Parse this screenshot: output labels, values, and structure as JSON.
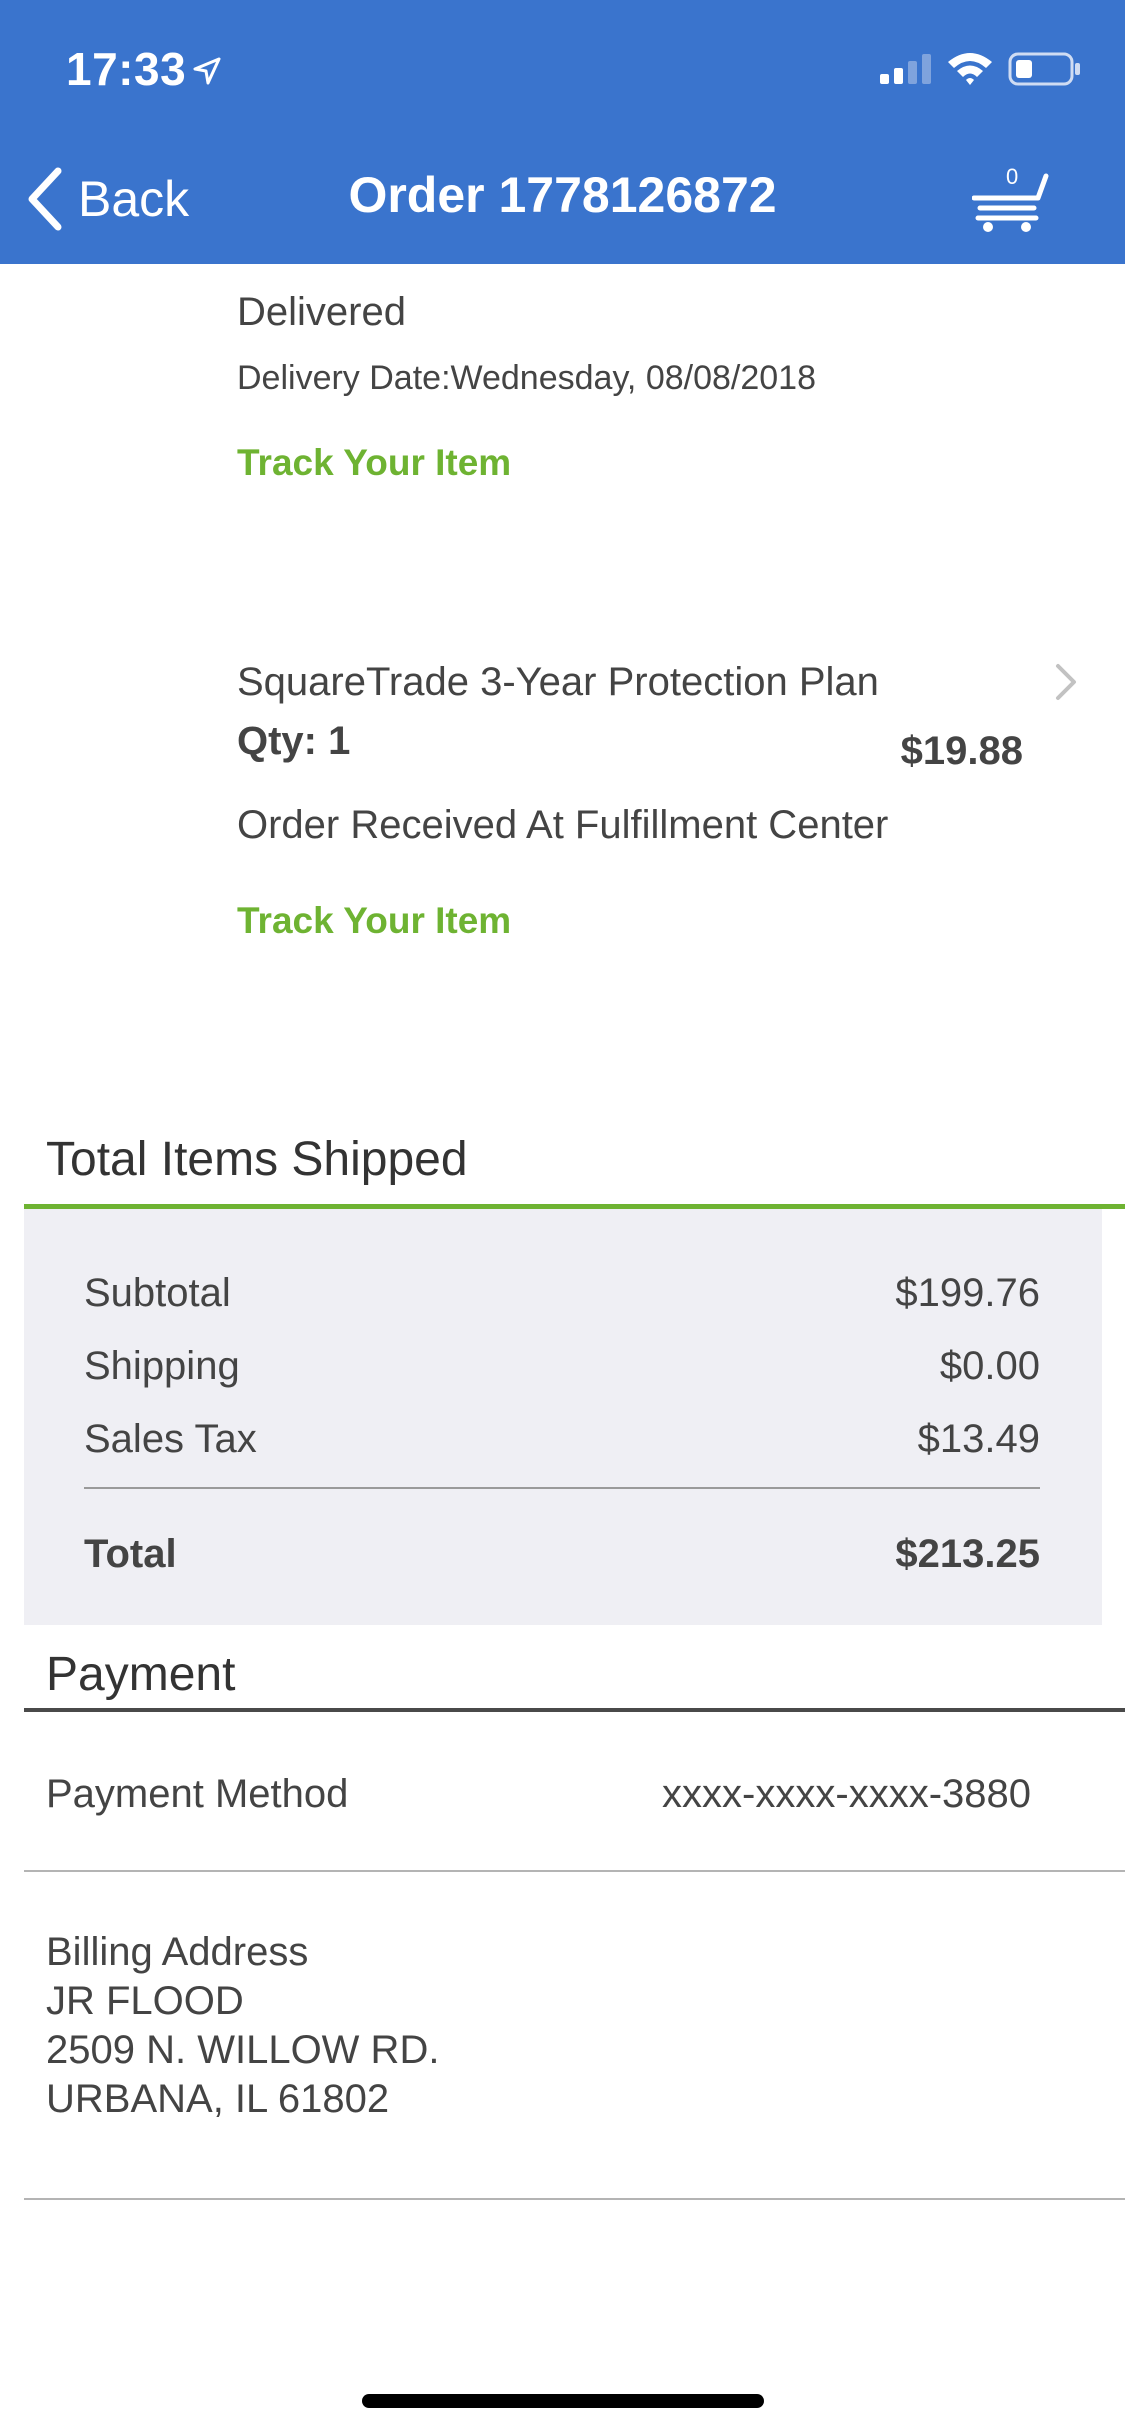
{
  "status_bar": {
    "time": "17:33"
  },
  "nav": {
    "back_label": "Back",
    "title": "Order 1778126872",
    "cart_count": "0"
  },
  "item1": {
    "status": "Delivered",
    "delivery_date": "Delivery Date:Wednesday, 08/08/2018",
    "track_label": "Track Your Item"
  },
  "item2": {
    "name": "SquareTrade 3-Year Protection Plan",
    "qty": "Qty: 1",
    "price": "$19.88",
    "status": "Order Received At Fulfillment Center",
    "track_label": "Track Your Item"
  },
  "totals": {
    "section_title": "Total Items Shipped",
    "subtotal_label": "Subtotal",
    "subtotal_value": "$199.76",
    "shipping_label": "Shipping",
    "shipping_value": "$0.00",
    "tax_label": "Sales Tax",
    "tax_value": "$13.49",
    "total_label": "Total",
    "total_value": "$213.25"
  },
  "payment": {
    "section_title": "Payment",
    "method_label": "Payment Method",
    "method_value": "xxxx-xxxx-xxxx-3880",
    "billing_label": "Billing Address",
    "billing_name": "JR FLOOD",
    "billing_street": "2509 N. WILLOW RD.",
    "billing_city": "URBANA, IL 61802"
  },
  "colors": {
    "header_blue": "#3a74cd",
    "link_green": "#6eb332",
    "summary_bg": "#efeff4"
  }
}
